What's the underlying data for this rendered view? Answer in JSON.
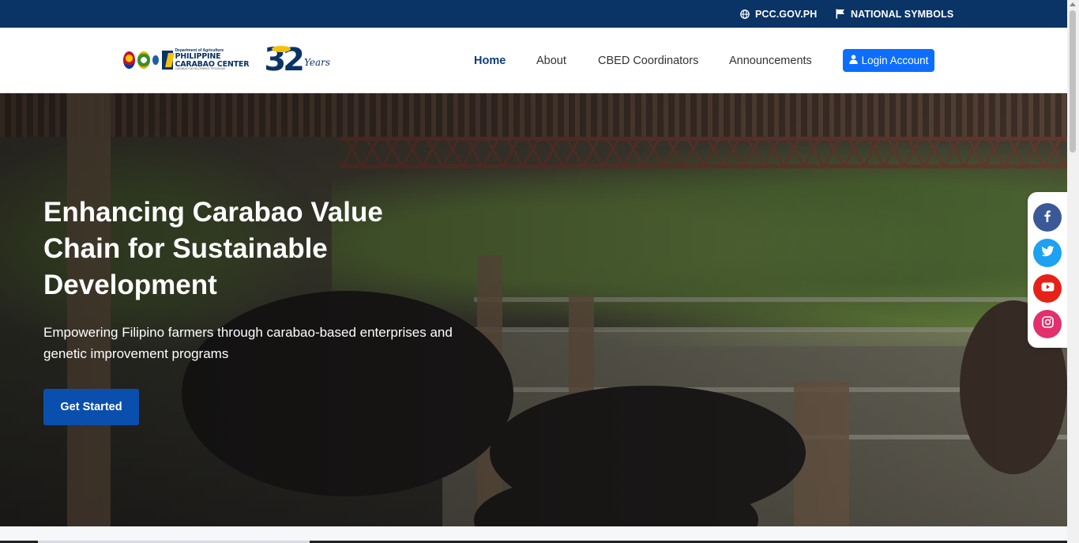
{
  "topbar": {
    "site_label": "PCC.GOV.PH",
    "site_icon": "globe-icon",
    "symbols_label": "NATIONAL SYMBOLS",
    "symbols_icon": "flag-icon",
    "background": "#0a3366"
  },
  "header": {
    "logo": {
      "dept_label": "Department of Agriculture",
      "center_name": "PHILIPPINE CARABAO CENTER",
      "tagline": "CARABAO DEVELOPMENT PROGRAM",
      "anniversary_number": "32",
      "anniversary_word": "Years"
    },
    "nav": [
      {
        "label": "Home",
        "active": true
      },
      {
        "label": "About",
        "active": false
      },
      {
        "label": "CBED Coordinators",
        "active": false
      },
      {
        "label": "Announcements",
        "active": false
      }
    ],
    "login_label": "Login Account",
    "login_icon": "user-icon",
    "accent": "#0d6efd"
  },
  "hero": {
    "title": "Enhancing Carabao Value Chain for Sustainable Development",
    "subtitle": "Empowering Filipino farmers through carabao-based enterprises and genetic improvement programs",
    "cta_label": "Get Started",
    "cta_color": "#0a4fae"
  },
  "social": [
    {
      "name": "facebook",
      "icon": "facebook-icon",
      "color": "#3b5998"
    },
    {
      "name": "twitter",
      "icon": "twitter-icon",
      "color": "#1da1f2"
    },
    {
      "name": "youtube",
      "icon": "youtube-icon",
      "color": "#e62117"
    },
    {
      "name": "instagram",
      "icon": "instagram-icon",
      "color": "#e1306c"
    }
  ]
}
